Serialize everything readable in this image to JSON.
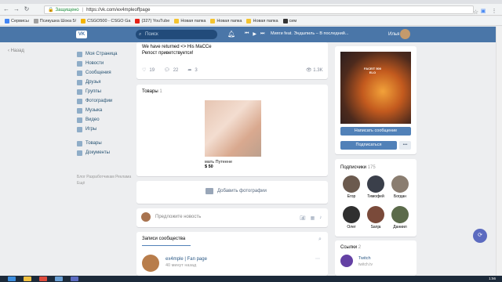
{
  "browser": {
    "secure_label": "Защищено",
    "url": "https://vk.com/ex4mpleoffpage",
    "bookmarks": [
      {
        "label": "Сервисы",
        "color": "#4285f4"
      },
      {
        "label": "Псикушка Шока 5/",
        "color": "#a0a0a0"
      },
      {
        "label": "CSGO500 - CSGO Ga",
        "color": "#f4b400"
      },
      {
        "label": "(327) YouTube",
        "color": "#e62117"
      },
      {
        "label": "Новая папка",
        "color": "#f4c430"
      },
      {
        "label": "Новая папка",
        "color": "#f4c430"
      },
      {
        "label": "Новая папка",
        "color": "#f4c430"
      },
      {
        "label": "сим",
        "color": "#333333"
      }
    ]
  },
  "header": {
    "logo": "VK",
    "search_placeholder": "Поиск",
    "track": "Мияги feat. Эндшпиль – В последний...",
    "username": "Илья",
    "accent": "#4a76a8"
  },
  "sidebar": {
    "back_label": "Назад",
    "items": [
      {
        "label": "Моя Страница"
      },
      {
        "label": "Новости"
      },
      {
        "label": "Сообщения"
      },
      {
        "label": "Друзья"
      },
      {
        "label": "Группы"
      },
      {
        "label": "Фотографии"
      },
      {
        "label": "Музыка"
      },
      {
        "label": "Видео"
      },
      {
        "label": "Игры"
      }
    ],
    "items2": [
      {
        "label": "Товары"
      },
      {
        "label": "Документы"
      }
    ],
    "footer": "Блог  Разработчикам  Реклама  Ещё"
  },
  "post": {
    "line1": "We have returned <> His MaCCe",
    "line2": "Репост приветствуется!",
    "likes": "19",
    "comments": "22",
    "shares": "3",
    "views": "1.3K"
  },
  "goods": {
    "title": "Товары",
    "count": "1",
    "product_name": "мать Путеене",
    "product_price": "$ 50"
  },
  "photos": {
    "add_label": "Добавить фотографии"
  },
  "composer": {
    "placeholder": "Предложите новость"
  },
  "wall": {
    "tab_label": "Записи сообщества",
    "author": "ex4mple | Fan page",
    "time": "40 минут назад"
  },
  "right": {
    "cover_caption": "FACEIT 500 ELO",
    "message_button": "Написать сообщение",
    "subscribe_button": "Подписаться",
    "more_button": "•••",
    "subscribers_title": "Подписчики",
    "subscribers_count": "175",
    "subscribers": [
      {
        "name": "Егор",
        "color": "#6b5a4e"
      },
      {
        "name": "Тимофей",
        "color": "#3a3f4a"
      },
      {
        "name": "Богдан",
        "color": "#8a7d70"
      },
      {
        "name": "Олег",
        "color": "#2f2f2f"
      },
      {
        "name": "Sanja",
        "color": "#7a4a3a"
      },
      {
        "name": "Даниил",
        "color": "#5b6a4a"
      }
    ],
    "links_title": "Ссылки",
    "links_count": "2",
    "link_name": "Twitch",
    "link_url": "twitch.tv"
  },
  "taskbar": {
    "clock": "1:56"
  }
}
